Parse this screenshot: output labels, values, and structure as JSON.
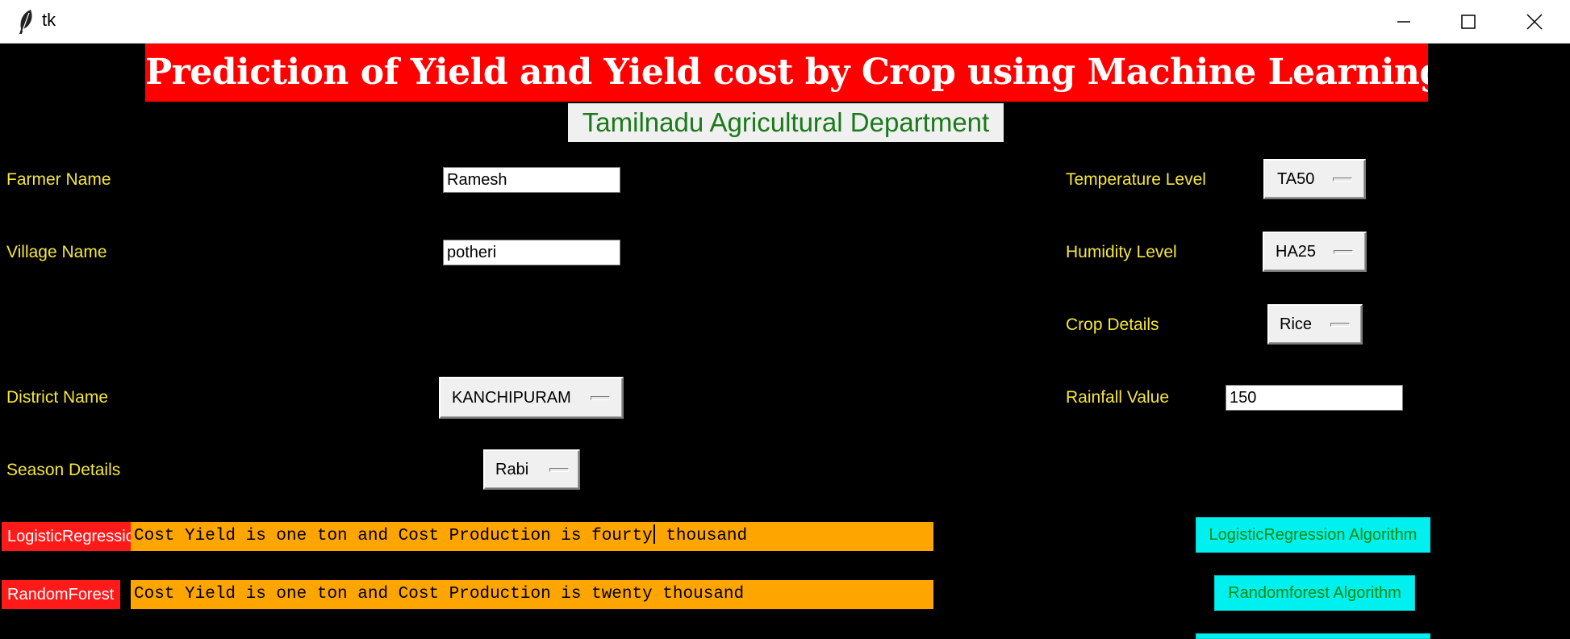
{
  "window": {
    "title": "tk",
    "icon": "feather-icon",
    "controls": [
      "minimize-icon",
      "maximize-icon",
      "close-icon"
    ]
  },
  "header": {
    "title": "Prediction of Yield and Yield cost by Crop using Machine Learning",
    "subtitle": "Tamilnadu Agricultural Department"
  },
  "form": {
    "farmer_label": "Farmer Name",
    "farmer_value": "Ramesh",
    "village_label": "Village Name",
    "village_value": "potheri",
    "district_label": "District Name",
    "district_value": "KANCHIPURAM",
    "season_label": "Season Details",
    "season_value": "Rabi",
    "temperature_label": "Temperature Level",
    "temperature_value": "TA50",
    "humidity_label": "Humidity Level",
    "humidity_value": "HA25",
    "crop_label": "Crop Details",
    "crop_value": "Rice",
    "rainfall_label": "Rainfall Value",
    "rainfall_value": "150"
  },
  "results": {
    "lr_label": "LogisticRegression",
    "lr_text_before_cursor": "Cost Yield is one ton and Cost Production is fourty",
    "lr_text_after_cursor": " thousand",
    "rf_label": "RandomForest",
    "rf_text": "Cost Yield is one ton and Cost Production is twenty thousand"
  },
  "buttons": {
    "lr_algorithm": "LogisticRegression Algorithm",
    "rf_algorithm": "Randomforest Algorithm"
  },
  "colors": {
    "background": "#000000",
    "banner": "#ff0000",
    "label_text": "#f5e63c",
    "result_bg": "#ffa500",
    "algo_button_bg": "#00f0f0",
    "algo_button_text": "#0a8a0a",
    "subtitle_text": "#1a7a1a"
  }
}
